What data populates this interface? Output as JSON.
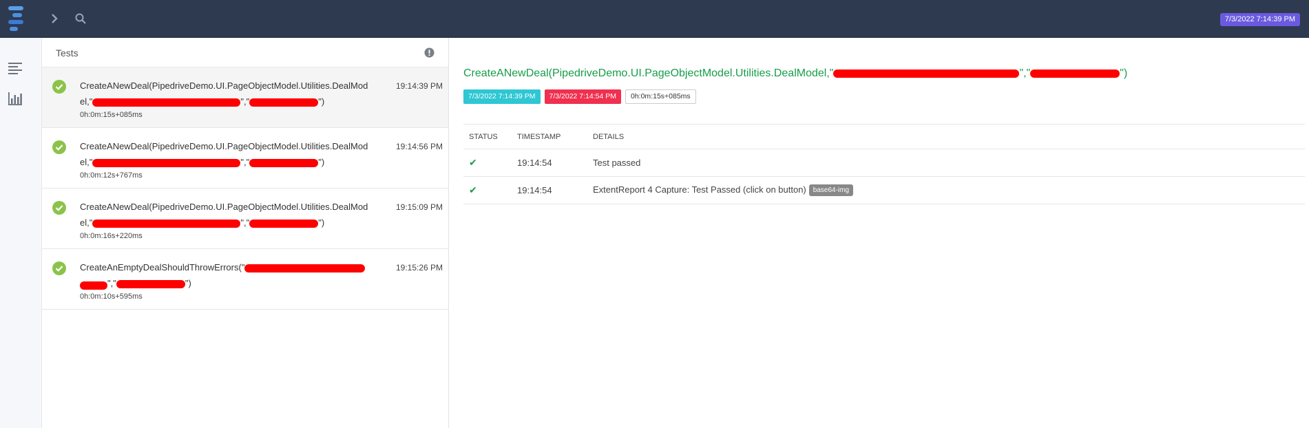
{
  "header": {
    "date_badge": "7/3/2022 7:14:39 PM",
    "logo_icon": "extent-logo-icon",
    "expand_icon": "chevron-right-icon",
    "search_icon": "search-icon"
  },
  "sidenav": {
    "items": [
      {
        "icon": "list-icon"
      },
      {
        "icon": "bar-chart-icon"
      }
    ]
  },
  "tests_panel": {
    "title": "Tests",
    "items": [
      {
        "name_prefix": "CreateANewDeal(PipedriveDemo.UI.PageObjectModel.Utilities.DealModel,\"",
        "name_mid": "\",\"",
        "name_suffix": "\")",
        "time": "19:14:39 PM",
        "duration": "0h:0m:15s+085ms",
        "status": "pass"
      },
      {
        "name_prefix": "CreateANewDeal(PipedriveDemo.UI.PageObjectModel.Utilities.DealModel,\"",
        "name_mid": "\",\"",
        "name_suffix": "\")",
        "time": "19:14:56 PM",
        "duration": "0h:0m:12s+767ms",
        "status": "pass"
      },
      {
        "name_prefix": "CreateANewDeal(PipedriveDemo.UI.PageObjectModel.Utilities.DealModel,\"",
        "name_mid": "\",\"",
        "name_suffix": "\")",
        "time": "19:15:09 PM",
        "duration": "0h:0m:16s+220ms",
        "status": "pass"
      },
      {
        "name_prefix": "CreateAnEmptyDealShouldThrowErrors(\"",
        "name_mid": "\",\"",
        "name_suffix": "\")",
        "time": "19:15:26 PM",
        "duration": "0h:0m:10s+595ms",
        "status": "pass"
      }
    ]
  },
  "detail": {
    "title_prefix": "CreateANewDeal(PipedriveDemo.UI.PageObjectModel.Utilities.DealModel,\"",
    "title_mid": "\",\"",
    "title_suffix": "\")",
    "start_time": "7/3/2022 7:14:39 PM",
    "end_time": "7/3/2022 7:14:54 PM",
    "duration": "0h:0m:15s+085ms",
    "columns": [
      "STATUS",
      "TIMESTAMP",
      "DETAILS"
    ],
    "rows": [
      {
        "status_icon": "check-icon",
        "timestamp": "19:14:54",
        "details": "Test passed",
        "badge": ""
      },
      {
        "status_icon": "check-icon",
        "timestamp": "19:14:54",
        "details": "ExtentReport 4 Capture: Test Passed (click on button)",
        "badge": "base64-img"
      }
    ]
  },
  "colors": {
    "topbar": "#2e3a50",
    "date_badge": "#6a5adf",
    "pass_green": "#8bc34a",
    "title_green": "#169d4a",
    "start_pill": "#2ec7d3",
    "end_pill": "#f0304f",
    "redaction": "#ff0000"
  }
}
